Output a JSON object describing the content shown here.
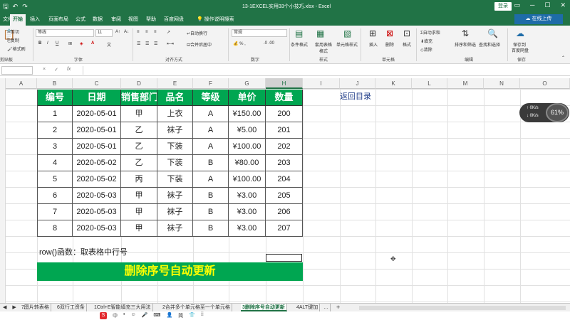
{
  "window": {
    "title": "13-1EXCEL实用33个小技巧.xlsx - Excel",
    "login_label": "登录",
    "qat_icons": [
      "save-icon",
      "undo-icon",
      "redo-icon"
    ]
  },
  "ribbon_tabs": {
    "items": [
      "文件",
      "开始",
      "插入",
      "页面布局",
      "公式",
      "数据",
      "审阅",
      "视图",
      "帮助",
      "百度网盘"
    ],
    "active": "开始",
    "tell_me": "操作说明搜索",
    "share": "在线上传"
  },
  "ribbon": {
    "clipboard": {
      "cut": "剪切",
      "copy": "复制",
      "format_painter": "格式刷",
      "label": "剪贴板"
    },
    "font": {
      "name": "等线",
      "size": "11",
      "label": "字体",
      "bold": "B",
      "italic": "I",
      "underline": "U"
    },
    "alignment": {
      "wrap": "自动换行",
      "merge": "合并后居中",
      "label": "对齐方式"
    },
    "number": {
      "format": "常规",
      "label": "数字"
    },
    "styles": {
      "conditional": "条件格式",
      "table": "套用表格格式",
      "cell_styles": "单元格样式",
      "label": "样式"
    },
    "cells": {
      "insert": "插入",
      "delete": "删除",
      "format": "格式",
      "label": "单元格"
    },
    "editing": {
      "autosum": "自动求和",
      "fill": "填充",
      "clear": "清除",
      "sort": "排序和筛选",
      "find": "查找和选择",
      "label": "编辑"
    },
    "save": {
      "label1": "保存到",
      "label2": "百度网盘",
      "label": "保存"
    }
  },
  "formula_bar": {
    "cancel": "×",
    "confirm": "✓",
    "fx": "fx"
  },
  "columns": [
    "A",
    "B",
    "C",
    "D",
    "E",
    "F",
    "G",
    "H",
    "I",
    "J",
    "K",
    "L",
    "M",
    "N",
    "O"
  ],
  "selected_column": "H",
  "table": {
    "headers": [
      "编号",
      "日期",
      "销售部门",
      "品名",
      "等级",
      "单价",
      "数量"
    ],
    "rows": [
      [
        "1",
        "2020-05-01",
        "甲",
        "上衣",
        "A",
        "¥150.00",
        "200"
      ],
      [
        "2",
        "2020-05-01",
        "乙",
        "袜子",
        "A",
        "¥5.00",
        "201"
      ],
      [
        "3",
        "2020-05-01",
        "乙",
        "下装",
        "A",
        "¥100.00",
        "202"
      ],
      [
        "4",
        "2020-05-02",
        "乙",
        "下装",
        "B",
        "¥80.00",
        "203"
      ],
      [
        "5",
        "2020-05-02",
        "丙",
        "下装",
        "A",
        "¥100.00",
        "204"
      ],
      [
        "6",
        "2020-05-03",
        "甲",
        "袜子",
        "B",
        "¥3.00",
        "205"
      ],
      [
        "7",
        "2020-05-03",
        "甲",
        "袜子",
        "B",
        "¥3.00",
        "206"
      ],
      [
        "8",
        "2020-05-03",
        "甲",
        "袜子",
        "B",
        "¥3.00",
        "207"
      ]
    ]
  },
  "return_link": "返回目录",
  "note": "row()函数：取表格中行号",
  "banner": "删除序号自动更新",
  "speed_widget": {
    "up": "0K/s",
    "down": "0K/s",
    "percent": "61%"
  },
  "sheet_tabs": {
    "nav": [
      "◀",
      "▶",
      "…"
    ],
    "items": [
      "7图片转表格",
      "6双行工资条",
      "1Ctrl+E智能填充三大用法",
      "2合并多个单元格至一个单元格",
      "3删除序号自动更新",
      "4ALT键加"
    ],
    "active_index": 4,
    "more": "…",
    "add": "+"
  },
  "ime_bar": {
    "logo": "S",
    "items": [
      "中",
      "•",
      "☺",
      "🎤",
      "⌨",
      "👤",
      "简",
      "👕",
      "⁞⁞"
    ]
  },
  "colors": {
    "excel_green": "#217346",
    "table_header": "#00a651",
    "banner_text": "#ffff00"
  }
}
